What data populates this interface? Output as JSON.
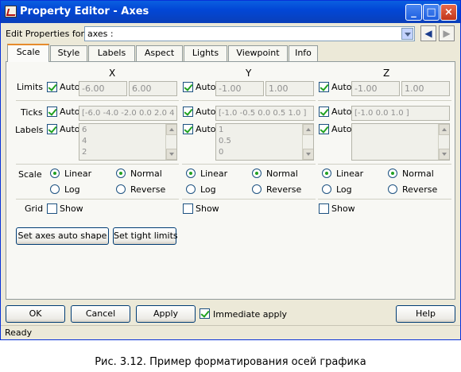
{
  "window": {
    "title": "Property Editor - Axes"
  },
  "edit_for": {
    "label": "Edit Properties for:",
    "value": "axes :"
  },
  "tabs": [
    "Scale",
    "Style",
    "Labels",
    "Aspect",
    "Lights",
    "Viewpoint",
    "Info"
  ],
  "axes": [
    {
      "name": "X",
      "limits": [
        "-6.00",
        "6.00"
      ],
      "ticks": "[-6.0 -4.0 -2.0 0.0 2.0 4",
      "labels": [
        "6",
        "4",
        "2"
      ],
      "scale": "Linear",
      "direction": "Normal"
    },
    {
      "name": "Y",
      "limits": [
        "-1.00",
        "1.00"
      ],
      "ticks": "[-1.0 -0.5 0.0 0.5 1.0 ]",
      "labels": [
        "1",
        "0.5",
        "0"
      ],
      "scale": "Linear",
      "direction": "Normal"
    },
    {
      "name": "Z",
      "limits": [
        "-1.00",
        "1.00"
      ],
      "ticks": "[-1.0 0.0 1.0 ]",
      "labels": [
        "",
        "",
        ""
      ],
      "scale": "Linear",
      "direction": "Normal"
    }
  ],
  "row_labels": {
    "limits": "Limits",
    "ticks": "Ticks",
    "labels": "Labels",
    "scale": "Scale",
    "grid": "Grid"
  },
  "auto_label": "Auto",
  "scale_options": {
    "linear": "Linear",
    "log": "Log",
    "normal": "Normal",
    "reverse": "Reverse"
  },
  "grid_show_label": "Show",
  "buttons": {
    "auto_shape": "Set axes auto shape",
    "tight_limits": "Set tight limits",
    "ok": "OK",
    "cancel": "Cancel",
    "apply": "Apply",
    "immediate_apply": "Immediate apply",
    "help": "Help"
  },
  "status": "Ready",
  "caption": "Рис. 3.12. Пример форматирования осей графика",
  "icons": {
    "app": "app-icon",
    "back": "back-arrow-icon",
    "forward": "forward-arrow-icon"
  },
  "colors": {
    "titlebar": "#0a5fe0",
    "window_bg": "#ece9d8",
    "check_green": "#21a121",
    "active_tab_accent": "#e68b2c"
  }
}
